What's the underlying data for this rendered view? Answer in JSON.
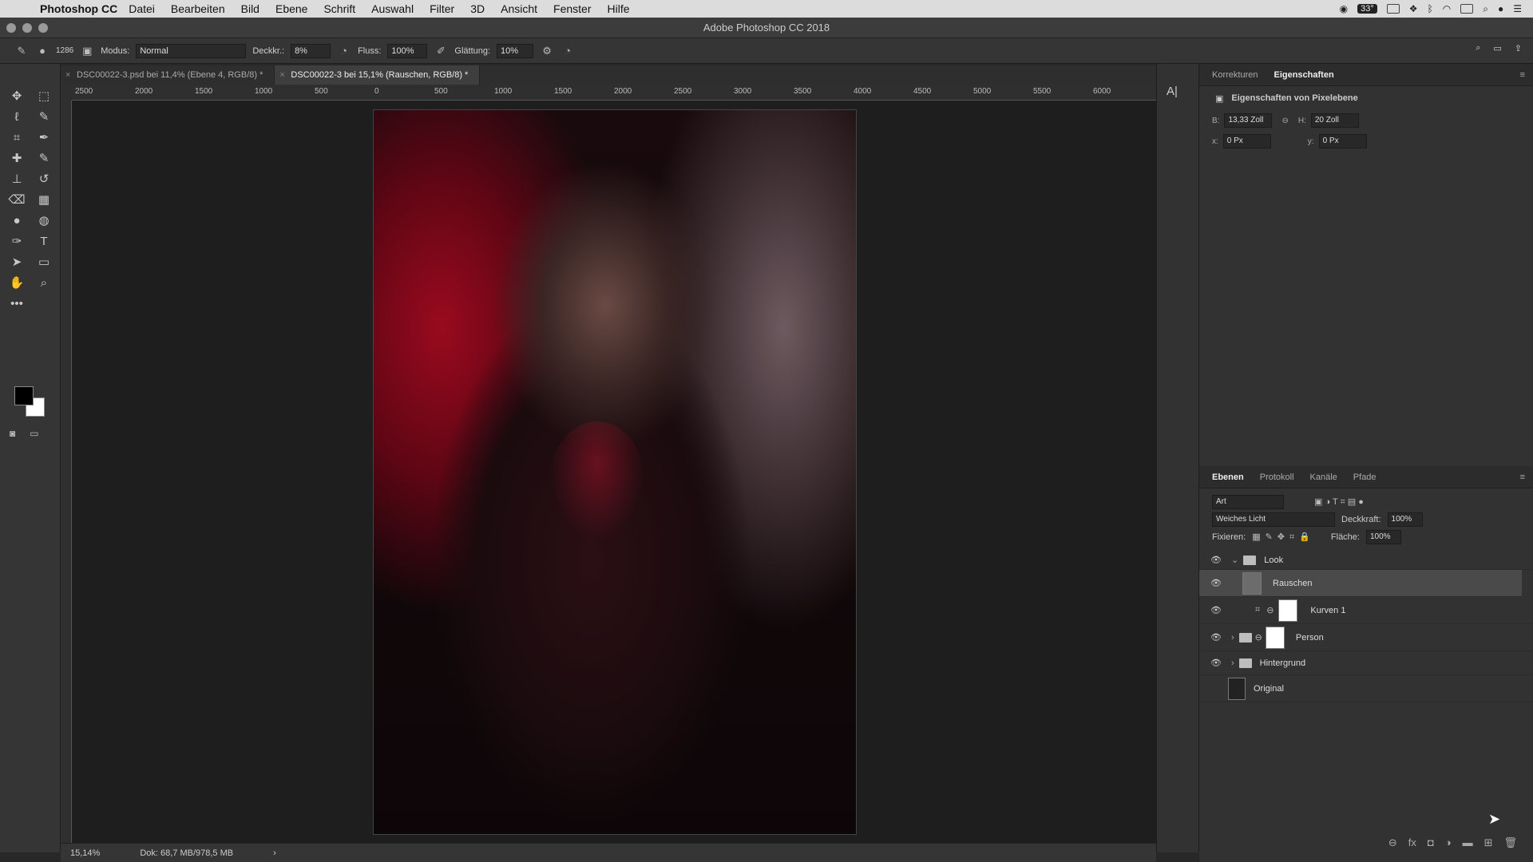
{
  "menubar": {
    "app": "Photoshop CC",
    "items": [
      "Datei",
      "Bearbeiten",
      "Bild",
      "Ebene",
      "Schrift",
      "Auswahl",
      "Filter",
      "3D",
      "Ansicht",
      "Fenster",
      "Hilfe"
    ],
    "temp": "33°"
  },
  "window": {
    "title": "Adobe Photoshop CC 2018"
  },
  "options": {
    "brush_size": "1286",
    "modus_label": "Modus:",
    "modus": "Normal",
    "deckkr_label": "Deckkr.:",
    "deckkr": "8%",
    "fluss_label": "Fluss:",
    "fluss": "100%",
    "glaettung_label": "Glättung:",
    "glaettung": "10%"
  },
  "tabs": [
    {
      "label": "DSC00022-3.psd bei 11,4% (Ebene 4, RGB/8) *"
    },
    {
      "label": "DSC00022-3 bei 15,1% (Rauschen, RGB/8) *"
    }
  ],
  "ruler": [
    "2500",
    "2000",
    "1500",
    "1000",
    "500",
    "0",
    "500",
    "1000",
    "1500",
    "2000",
    "2500",
    "3000",
    "3500",
    "4000",
    "4500",
    "5000",
    "5500",
    "6000"
  ],
  "status": {
    "zoom": "15,14%",
    "doc": "Dok: 68,7 MB/978,5 MB"
  },
  "properties": {
    "tabs": [
      "Korrekturen",
      "Eigenschaften"
    ],
    "title": "Eigenschaften von Pixelebene",
    "b_label": "B:",
    "b": "13,33 Zoll",
    "h_label": "H:",
    "h": "20 Zoll",
    "x_label": "x:",
    "x": "0 Px",
    "y_label": "y:",
    "y": "0 Px"
  },
  "layers_panel": {
    "tabs": [
      "Ebenen",
      "Protokoll",
      "Kanäle",
      "Pfade"
    ],
    "filter": "Art",
    "blend": "Weiches Licht",
    "opacity_label": "Deckkraft:",
    "opacity": "100%",
    "lock_label": "Fixieren:",
    "fill_label": "Fläche:",
    "fill": "100%",
    "layers": [
      {
        "name": "Look"
      },
      {
        "name": "Rauschen"
      },
      {
        "name": "Kurven 1"
      },
      {
        "name": "Person"
      },
      {
        "name": "Hintergrund"
      },
      {
        "name": "Original"
      }
    ]
  }
}
